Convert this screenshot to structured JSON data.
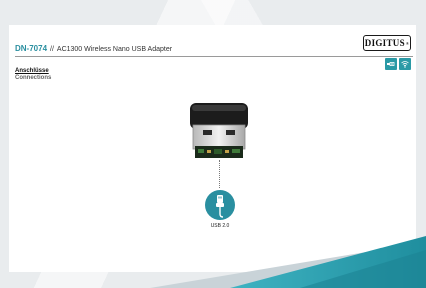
{
  "brand": {
    "logo_text": "DIGITUS",
    "logo_mark": "®"
  },
  "header": {
    "model": "DN-7074",
    "separator": "//",
    "product": "AC1300 Wireless Nano USB Adapter"
  },
  "section": {
    "title_de": "Anschlüsse",
    "title_en": "Connections"
  },
  "badges": [
    {
      "icon": "usb-plug-icon"
    },
    {
      "icon": "wifi-icon"
    }
  ],
  "connector": {
    "icon": "usb-cable-icon",
    "label": "USB 2.0"
  },
  "colors": {
    "accent": "#2a8fa0",
    "background": "#e9ecee"
  }
}
